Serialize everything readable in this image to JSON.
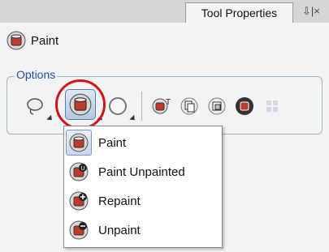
{
  "tabs": {
    "active": "Tool Properties",
    "controls": "⇩|×"
  },
  "tool": {
    "title": "Paint",
    "icon": "paint-bucket-icon"
  },
  "options": {
    "label": "Options"
  },
  "toolbar": {
    "buttons": [
      "lasso-icon",
      "paint-bucket-icon",
      "circle-icon",
      "paint-text-icon",
      "copy-paste-icon",
      "paste-icon",
      "paint-replace-icon",
      "grid-icon"
    ]
  },
  "menu": {
    "items": [
      {
        "label": "Paint",
        "icon": "paint-bucket-icon"
      },
      {
        "label": "Paint Unpainted",
        "icon": "paint-unpainted-icon"
      },
      {
        "label": "Repaint",
        "icon": "repaint-icon"
      },
      {
        "label": "Unpaint",
        "icon": "unpaint-icon"
      }
    ]
  },
  "colors": {
    "accent": "#1f4fb0",
    "highlight": "#d5121b",
    "paint": "#c0392b"
  }
}
